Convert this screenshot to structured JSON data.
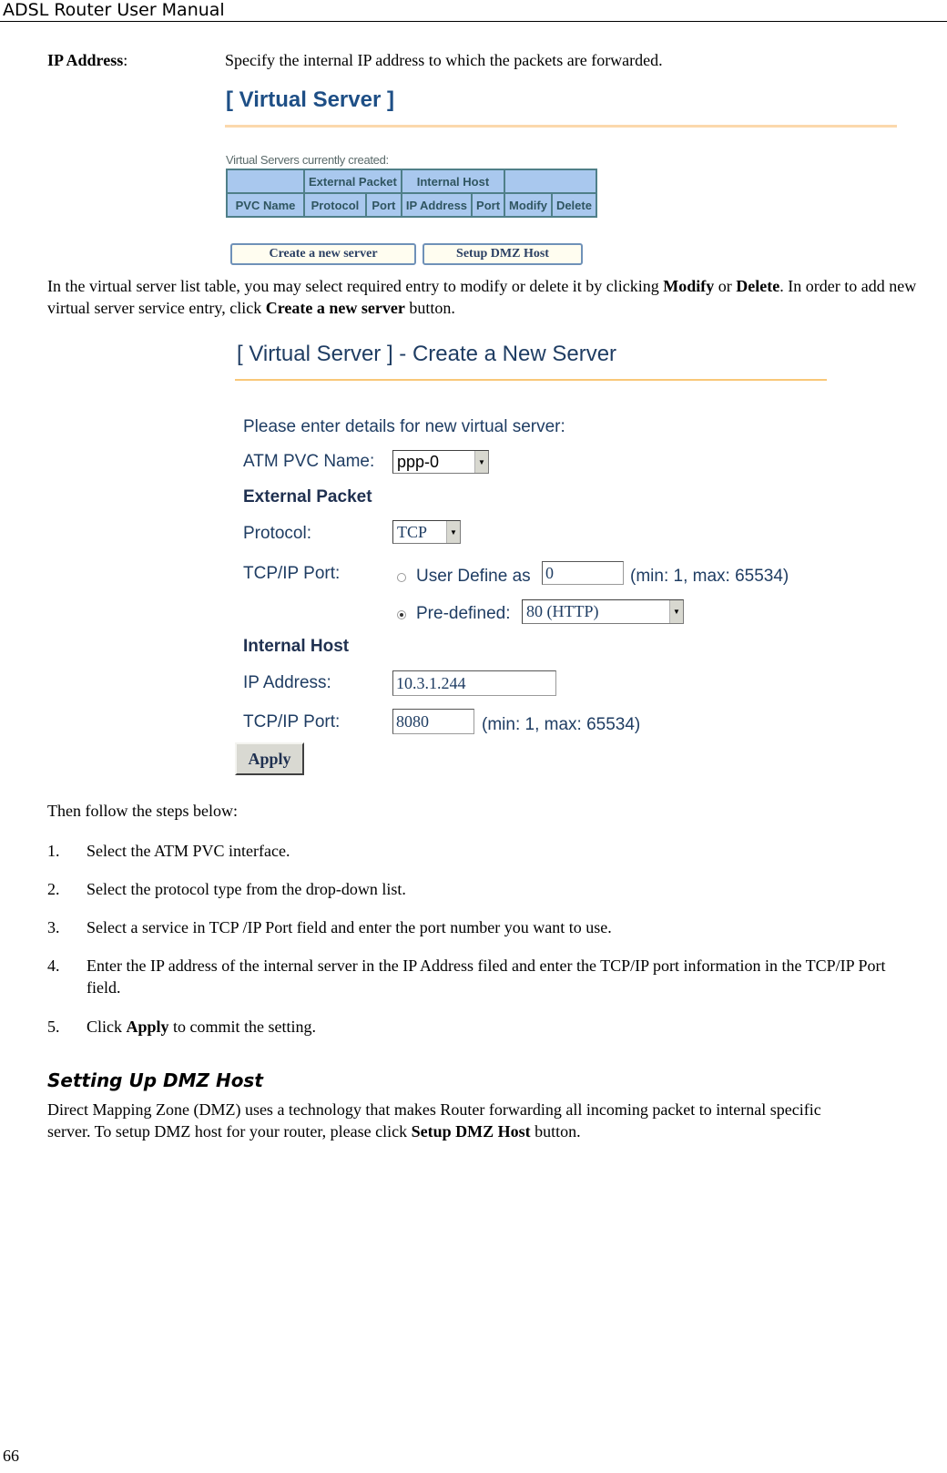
{
  "header": {
    "title": "ADSL Router User Manual"
  },
  "ip_address_entry": {
    "term": "IP Address",
    "colon": ":",
    "definition": "Specify the internal IP address to which the packets are forwarded."
  },
  "virtual_server_screen": {
    "title": "[ Virtual Server ]",
    "caption": "Virtual Servers currently created:",
    "table": {
      "group_headers": [
        "",
        "External Packet",
        "Internal Host",
        ""
      ],
      "columns": [
        "PVC Name",
        "Protocol",
        "Port",
        "IP Address",
        "Port",
        "Modify",
        "Delete"
      ]
    },
    "buttons": {
      "create": "Create a new server",
      "dmz": "Setup DMZ Host"
    }
  },
  "paragraph_modify": {
    "part1": "In the virtual server list table, you may select required entry to modify or delete it by clicking ",
    "modify": "Modify",
    "or": " or ",
    "delete": "Delete",
    "part2": ". In order to add new virtual server service entry, click ",
    "create": "Create a new server",
    "part3": " button."
  },
  "create_server_screen": {
    "title": "[ Virtual Server ] - Create a New Server",
    "intro": "Please enter details for new virtual server:",
    "atm_pvc_label": "ATM PVC Name:",
    "atm_pvc_value": "ppp-0",
    "external_packet_heading": "External Packet",
    "protocol_label": "Protocol:",
    "protocol_value": "TCP",
    "tcp_port_label": "TCP/IP Port:",
    "user_define_label": "User Define as",
    "user_define_value": "0",
    "user_define_selected": false,
    "range_hint": "(min: 1, max: 65534)",
    "predefined_label": "Pre-defined:",
    "predefined_value": "80 (HTTP)",
    "predefined_selected": true,
    "internal_host_heading": "Internal Host",
    "ip_label": "IP Address:",
    "ip_value": "10.3.1.244",
    "internal_port_label": "TCP/IP Port:",
    "internal_port_value": "8080",
    "internal_range_hint": "(min: 1, max: 65534)",
    "apply_label": "Apply"
  },
  "steps_intro": "Then follow the steps below:",
  "steps": [
    {
      "num": "1.",
      "text": "Select the ATM PVC interface."
    },
    {
      "num": "2.",
      "text": "Select the protocol type from the drop-down list."
    },
    {
      "num": "3.",
      "text": "Select a service in TCP /IP Port field and enter the port number you want to use."
    },
    {
      "num": "4.",
      "text": "Enter the IP address of the internal server in the IP Address filed and enter the TCP/IP port information in the TCP/IP Port field."
    },
    {
      "num": "5.",
      "pre": "Click ",
      "bold": "Apply",
      "post": " to commit the setting."
    }
  ],
  "dmz_section": {
    "heading": "Setting Up DMZ Host",
    "text": "Direct Mapping Zone (DMZ) uses a technology that makes Router forwarding all incoming packet to internal specific server. To setup DMZ host for your router, please click ",
    "bold": "Setup DMZ Host",
    "post": " button."
  },
  "footer": {
    "page_number": "66"
  },
  "colors": {
    "ui_title": "#1e4f86",
    "orange_rule": "#fbd8ac",
    "table_fill": "#a9c8ee",
    "table_border": "#4f7f88"
  }
}
